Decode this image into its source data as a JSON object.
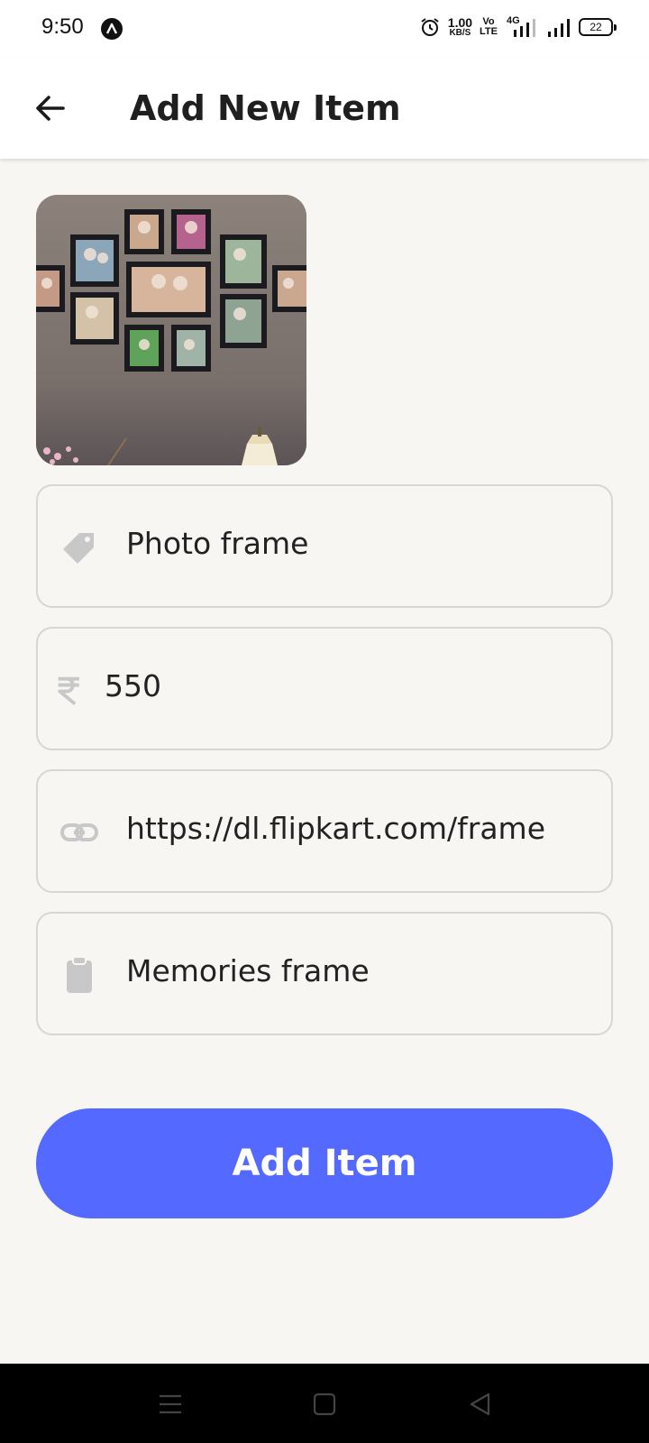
{
  "status_bar": {
    "time": "9:50",
    "net_speed_value": "1.00",
    "net_speed_unit": "KB/S",
    "volte_top": "Vo",
    "volte_bottom": "LTE",
    "network_type": "4G",
    "battery_level": "22"
  },
  "app_bar": {
    "title": "Add New Item"
  },
  "form": {
    "name_value": "Photo frame",
    "price_value": "550",
    "link_value": "https://dl.flipkart.com/frame",
    "description_value": "Memories frame",
    "submit_label": "Add Item"
  },
  "colors": {
    "primary": "#5469ff",
    "background": "#f8f6f3",
    "icon_gray": "#c8c8c8"
  },
  "icons": [
    "back-arrow-icon",
    "tag-icon",
    "rupee-icon",
    "link-icon",
    "clipboard-icon",
    "menu-icon",
    "home-square-icon",
    "back-triangle-icon"
  ]
}
